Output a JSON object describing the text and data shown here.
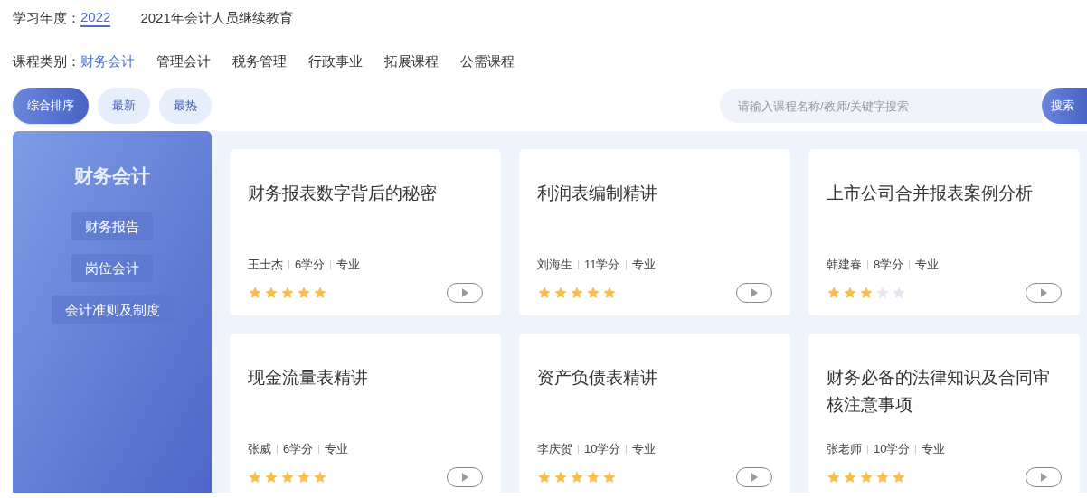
{
  "year_filter": {
    "label": "学习年度：",
    "years": [
      {
        "label": "2022",
        "selected": true
      }
    ],
    "program": "2021年会计人员继续教育"
  },
  "category_filter": {
    "label": "课程类别：",
    "categories": [
      {
        "label": "财务会计",
        "selected": true
      },
      {
        "label": "管理会计",
        "selected": false
      },
      {
        "label": "税务管理",
        "selected": false
      },
      {
        "label": "行政事业",
        "selected": false
      },
      {
        "label": "拓展课程",
        "selected": false
      },
      {
        "label": "公需课程",
        "selected": false
      }
    ]
  },
  "sort_buttons": [
    {
      "label": "综合排序",
      "selected": true
    },
    {
      "label": "最新",
      "selected": false
    },
    {
      "label": "最热",
      "selected": false
    }
  ],
  "search": {
    "placeholder": "请输入课程名称/教师/关键字搜索",
    "button": "搜索"
  },
  "sidebar": {
    "title": "财务会计",
    "items": [
      "财务报告",
      "岗位会计",
      "会计准则及制度"
    ]
  },
  "courses": [
    {
      "title": "财务报表数字背后的秘密",
      "teacher": "王士杰",
      "credits": "6学分",
      "type": "专业",
      "stars": 5
    },
    {
      "title": "利润表编制精讲",
      "teacher": "刘海生",
      "credits": "11学分",
      "type": "专业",
      "stars": 5
    },
    {
      "title": "上市公司合并报表案例分析",
      "teacher": "韩建春",
      "credits": "8学分",
      "type": "专业",
      "stars": 3
    },
    {
      "title": "现金流量表精讲",
      "teacher": "张威",
      "credits": "6学分",
      "type": "专业",
      "stars": 5
    },
    {
      "title": "资产负债表精讲",
      "teacher": "李庆贺",
      "credits": "10学分",
      "type": "专业",
      "stars": 5
    },
    {
      "title": "财务必备的法律知识及合同审核注意事项",
      "teacher": "张老师",
      "credits": "10学分",
      "type": "专业",
      "stars": 5
    }
  ]
}
